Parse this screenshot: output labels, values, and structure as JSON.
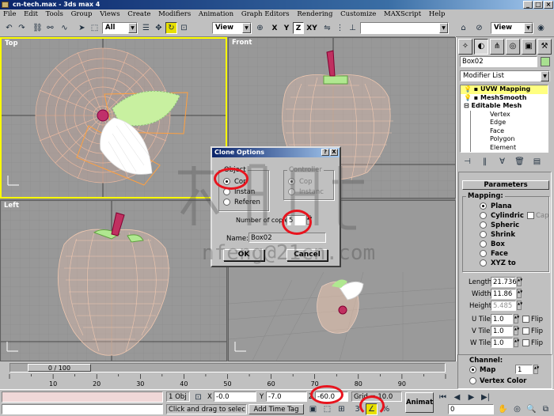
{
  "window": {
    "title": "cn-tech.max - 3ds max 4"
  },
  "menu": [
    "File",
    "Edit",
    "Tools",
    "Group",
    "Views",
    "Create",
    "Modifiers",
    "Animation",
    "Graph Editors",
    "Rendering",
    "Customize",
    "MAXScript",
    "Help"
  ],
  "toolbar": {
    "selection_filter": "All",
    "ref_coord": "View",
    "axes": [
      "X",
      "Y",
      "Z",
      "XY"
    ],
    "named_selection": "",
    "view_dropdown": "View"
  },
  "viewports": {
    "top": "Top",
    "front": "Front",
    "left": "Left",
    "perspective": ""
  },
  "command_panel": {
    "object_name": "Box02",
    "object_color": "#a8e090",
    "modifier_list": "Modifier List",
    "stack": [
      "UVW Mapping",
      "MeshSmooth",
      "Editable Mesh",
      "Vertex",
      "Edge",
      "Face",
      "Polygon",
      "Element"
    ],
    "parameters_title": "Parameters",
    "mapping": {
      "group": "Mapping:",
      "options": [
        "Plana",
        "Cylindric",
        "Spheric",
        "Shrink",
        "Box",
        "Face",
        "XYZ to"
      ],
      "selected": 0,
      "cap_label": "Cap"
    },
    "length_label": "Length:",
    "length": "21.736",
    "width_label": "Width:",
    "width": "11.86",
    "height_label": "Height:",
    "height": "5.485",
    "utile_label": "U Tile:",
    "utile": "1.0",
    "vtile_label": "V Tile:",
    "vtile": "1.0",
    "wtile_label": "W Tile:",
    "wtile": "1.0",
    "flip_label": "Flip",
    "channel": {
      "group": "Channel:",
      "options": [
        "Map",
        "Vertex Color"
      ],
      "selected": 0,
      "value": "1"
    }
  },
  "timeline": {
    "frame_display": "0 / 100",
    "ticks": [
      10,
      20,
      30,
      40,
      50,
      60,
      70,
      80,
      90
    ]
  },
  "status": {
    "selection_count": "1 Obj",
    "x_label": "X",
    "x": "-0.0",
    "y_label": "Y",
    "y": "-7.0",
    "z_label": "Z",
    "z": "-60.0",
    "grid": "Grid = 10.0",
    "prompt": "Click and drag to selec",
    "add_time_tag": "Add Time Tag",
    "animate": "Animate",
    "current_frame": "0"
  },
  "clone_dialog": {
    "title": "Clone Options",
    "help_btn": "?",
    "close_btn": "X",
    "object_group": "Object",
    "object_options": [
      "Cop",
      "Instan",
      "Referen"
    ],
    "object_selected": 0,
    "controller_group": "Controller",
    "controller_options": [
      "Cop",
      "Instanc"
    ],
    "controller_selected": 0,
    "copies_label": "Number of copie",
    "copies": "5",
    "name_label": "Name:",
    "name": "Box02",
    "ok": "OK",
    "cancel": "Cancel"
  },
  "watermark": {
    "text": "nfeng@21cn.com"
  }
}
